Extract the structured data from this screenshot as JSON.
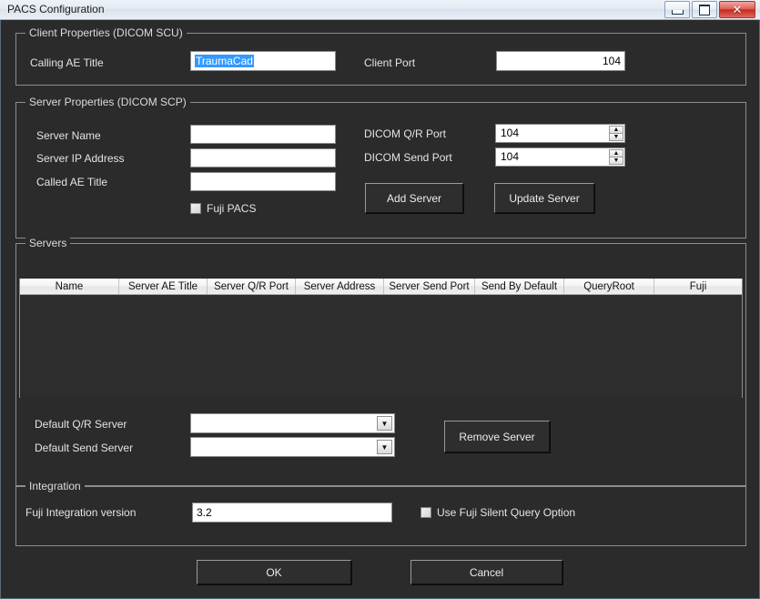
{
  "window": {
    "title": "PACS Configuration",
    "controls": {
      "minimize": "minimize-button",
      "maximize": "maximize-button",
      "close_glyph": "✕"
    }
  },
  "client_properties": {
    "legend": "Client Properties (DICOM SCU)",
    "calling_ae_title_label": "Calling AE Title",
    "calling_ae_title_value": "TraumaCad",
    "client_port_label": "Client Port",
    "client_port_value": "104"
  },
  "server_properties": {
    "legend": "Server Properties (DICOM SCP)",
    "server_name_label": "Server Name",
    "server_name_value": "",
    "server_ip_label": "Server IP Address",
    "server_ip_value": "",
    "called_ae_label": "Called AE Title",
    "called_ae_value": "",
    "fuji_pacs_label": "Fuji PACS",
    "fuji_pacs_checked": false,
    "qr_port_label": "DICOM Q/R Port",
    "qr_port_value": "104",
    "send_port_label": "DICOM Send Port",
    "send_port_value": "104",
    "add_server_label": "Add Server",
    "update_server_label": "Update Server",
    "spin_up": "▲",
    "spin_down": "▼"
  },
  "servers": {
    "legend": "Servers",
    "columns": [
      "Name",
      "Server AE Title",
      "Server Q/R Port",
      "Server Address",
      "Server Send Port",
      "Send By Default",
      "QueryRoot",
      "Fuji"
    ],
    "rows": [],
    "default_qr_label": "Default Q/R Server",
    "default_qr_value": "",
    "default_send_label": "Default Send Server",
    "default_send_value": "",
    "remove_server_label": "Remove Server",
    "dropdown_arrow": "▼"
  },
  "integration": {
    "legend": "Integration",
    "version_label": "Fuji Integration version",
    "version_value": "3.2",
    "silent_query_label": "Use Fuji Silent Query Option",
    "silent_query_checked": false
  },
  "footer": {
    "ok_label": "OK",
    "cancel_label": "Cancel"
  },
  "colors": {
    "dialog_background": "#2b2b2b",
    "titlebar": "#e3eaf2",
    "selection_highlight": "#3399ff",
    "close_button": "#c32b1e",
    "field_background": "#ffffff",
    "group_border": "#8d8d8d"
  }
}
